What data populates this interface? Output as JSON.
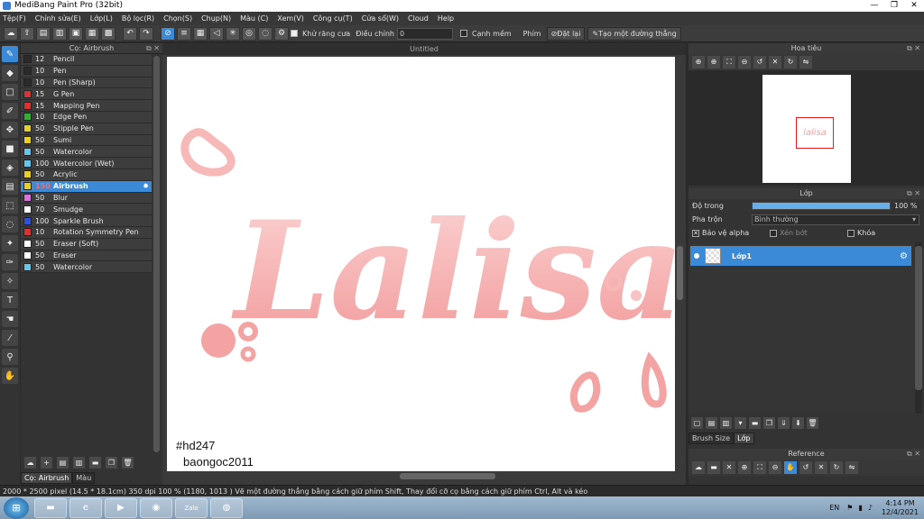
{
  "window": {
    "title": "MediBang Paint Pro (32bit)",
    "minimize": "—",
    "maximize": "❐",
    "close": "✕"
  },
  "menu": [
    "Tệp(F)",
    "Chỉnh sửa(E)",
    "Lớp(L)",
    "Bộ lọc(R)",
    "Chọn(S)",
    "Chụp(N)",
    "Màu (C)",
    "Xem(V)",
    "Công cụ(T)",
    "Cửa sổ(W)",
    "Cloud",
    "Help"
  ],
  "toolbar": {
    "antialias_label": "Khử răng cưa",
    "correction_label": "Điều chỉnh",
    "correction_value": "0",
    "edge_label": "Cạnh mềm",
    "key_label": "Phím",
    "reset_label": "Đặt lại",
    "straight_label": "Tạo một đường thẳng"
  },
  "brush_panel": {
    "title": "Cọ: Airbrush",
    "items": [
      {
        "size": "12",
        "name": "Pencil",
        "color": "#2a2a2a"
      },
      {
        "size": "10",
        "name": "Pen",
        "color": "#2a2a2a"
      },
      {
        "size": "10",
        "name": "Pen (Sharp)",
        "color": "#2a2a2a"
      },
      {
        "size": "15",
        "name": "G Pen",
        "color": "#e03030"
      },
      {
        "size": "15",
        "name": "Mapping Pen",
        "color": "#e03030"
      },
      {
        "size": "10",
        "name": "Edge Pen",
        "color": "#30b030"
      },
      {
        "size": "50",
        "name": "Stipple Pen",
        "color": "#e8d020"
      },
      {
        "size": "50",
        "name": "Sumi",
        "color": "#e8d020"
      },
      {
        "size": "50",
        "name": "Watercolor",
        "color": "#60c8f0"
      },
      {
        "size": "100",
        "name": "Watercolor (Wet)",
        "color": "#60c8f0"
      },
      {
        "size": "50",
        "name": "Acrylic",
        "color": "#e8d020"
      },
      {
        "size": "150",
        "name": "Airbrush",
        "color": "#e8d020",
        "selected": true
      },
      {
        "size": "50",
        "name": "Blur",
        "color": "#e070e0"
      },
      {
        "size": "70",
        "name": "Smudge",
        "color": "#ffffff"
      },
      {
        "size": "100",
        "name": "Sparkle Brush",
        "color": "#3050e0"
      },
      {
        "size": "10",
        "name": "Rotation Symmetry Pen",
        "color": "#e03030"
      },
      {
        "size": "50",
        "name": "Eraser (Soft)",
        "color": "#ffffff"
      },
      {
        "size": "50",
        "name": "Eraser",
        "color": "#ffffff"
      },
      {
        "size": "50",
        "name": "Watercolor",
        "color": "#60c8f0"
      }
    ],
    "tabs": [
      "Cọ: Airbrush",
      "Màu"
    ]
  },
  "canvas": {
    "doc_title": "Untitled",
    "art_text": "Lalisa",
    "watermark_1": "#hd247",
    "watermark_2": "baongoc2011"
  },
  "navigator": {
    "title": "Hoa tiêu",
    "thumb_text": "lalisa"
  },
  "layer_panel": {
    "title": "Lớp",
    "opacity_label": "Độ trong",
    "opacity_value": "100 %",
    "opacity_fraction": 1.0,
    "blend_label": "Pha trộn",
    "blend_value": "Bình thường",
    "protect_alpha": "Bảo vệ alpha",
    "clipping": "Xén bớt",
    "lock": "Khóa",
    "layer_name": "Lớp1",
    "tabs": [
      "Brush Size",
      "Lớp"
    ]
  },
  "reference": {
    "title": "Reference"
  },
  "status": "2000 * 2500 pixel   (14.5 * 18.1cm)   350 dpi   100 %   (1180, 1013 )   Vẽ một đường thẳng bằng cách giữ phím Shift, Thay đổi cỡ cọ bằng cách giữ phím Ctrl, Alt và kéo",
  "taskbar": {
    "apps": [
      "explorer-icon",
      "ie-icon",
      "media-icon",
      "app-icon",
      "zalo-icon",
      "chrome-icon"
    ],
    "zalo_label": "Zalo",
    "lang": "EN",
    "time": "4:14 PM",
    "date": "12/4/2021"
  },
  "colors": {
    "accent": "#3b8ad8",
    "art_pink": "#f4a3a3"
  }
}
